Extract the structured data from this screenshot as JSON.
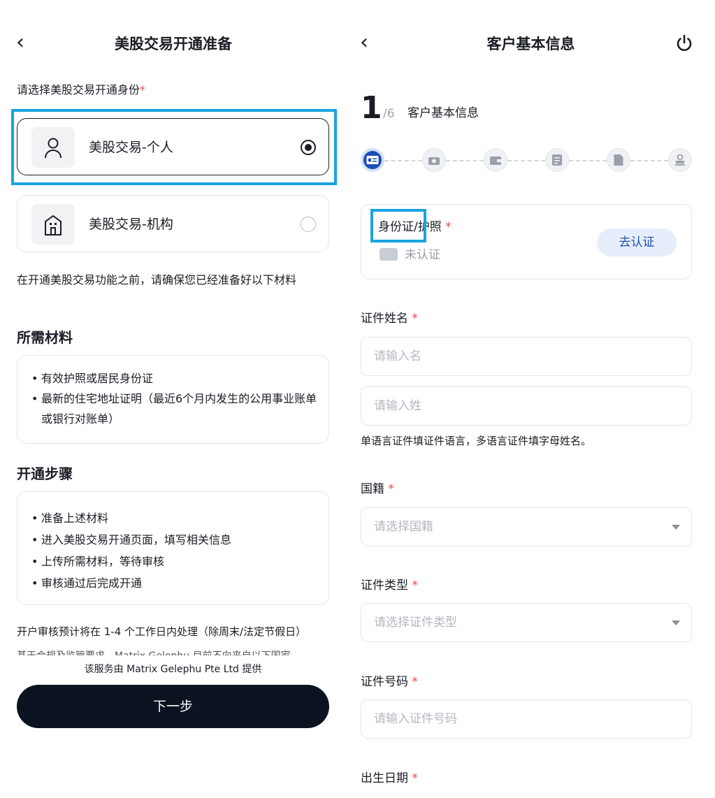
{
  "left": {
    "back_icon": "‹",
    "title": "美股交易开通准备",
    "choose_label": "请选择美股交易开通身份",
    "required_mark": "*",
    "options": [
      {
        "label": "美股交易-个人",
        "icon": "person-icon",
        "selected": true
      },
      {
        "label": "美股交易-机构",
        "icon": "building-icon",
        "selected": false
      }
    ],
    "intro": "在开通美股交易功能之前，请确保您已经准备好以下材料",
    "materials_title": "所需材料",
    "materials": [
      "有效护照或居民身份证",
      "最新的住宅地址证明（最近6个月内发生的公用事业账单或银行对账单）"
    ],
    "steps_title": "开通步骤",
    "steps": [
      "准备上述材料",
      "进入美股交易开通页面，填写相关信息",
      "上传所需材料，等待审核",
      "审核通过后完成开通"
    ],
    "notice_line1": "开户审核预计将在 1-4 个工作日内处理（除周末/法定节假日）",
    "notice_line2": "基于合规及监管要求，Matrix Gelephu 目前不向来自以下国家",
    "service_provider": "该服务由 Matrix Gelephu Pte Ltd 提供",
    "next_button": "下一步"
  },
  "right": {
    "back_icon": "‹",
    "title": "客户基本信息",
    "power_icon": "power-icon",
    "step_current": "1",
    "step_total": "/6",
    "step_label": "客户基本信息",
    "stepper_icons": [
      "id-card-icon",
      "camera-icon",
      "wallet-icon",
      "checklist-icon",
      "document-icon",
      "stamp-icon"
    ],
    "id_section": {
      "label": "身份证/护照",
      "status": "未认证",
      "verify_button": "去认证"
    },
    "name_label": "证件姓名",
    "first_name_placeholder": "请输入名",
    "last_name_placeholder": "请输入姓",
    "name_hint": "单语言证件填证件语言，多语言证件填字母姓名。",
    "nationality_label": "国籍",
    "nationality_placeholder": "请选择国籍",
    "id_type_label": "证件类型",
    "id_type_placeholder": "请选择证件类型",
    "id_number_label": "证件号码",
    "id_number_placeholder": "请输入证件号码",
    "birth_label": "出生日期"
  },
  "colors": {
    "primary_dark": "#0c1320",
    "accent_blue": "#1b4fb7",
    "highlight": "#1aa3e0",
    "required": "#e5484d"
  }
}
